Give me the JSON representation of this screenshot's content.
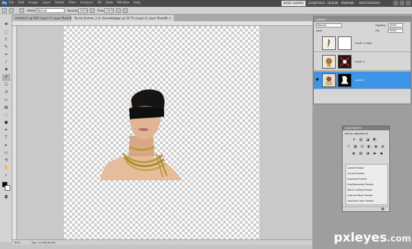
{
  "app": {
    "logo": "Ps"
  },
  "menubar": {
    "items": [
      "File",
      "Edit",
      "Image",
      "Layer",
      "Select",
      "Filter",
      "Analysis",
      "3D",
      "View",
      "Window",
      "Help"
    ],
    "workspaces": [
      "BASIC SHAPES",
      "ESSENTIALS",
      "DESIGN",
      "PAINTING",
      "PHOTOGRAPHY"
    ],
    "active_workspace": "BASIC SHAPES"
  },
  "options_bar": {
    "mode_label": "Mode:",
    "mode_value": "Normal",
    "opacity_label": "Opacity:",
    "opacity_value": "100%",
    "flow_label": "Flow:",
    "flow_value": "100%"
  },
  "tabs": [
    {
      "label": "Untitled-1 @ 50% (Layer 0, Layer Mask/8) ×",
      "active": false
    },
    {
      "label": "Tarnet_Human_1.hc (Snowtolgtga) @ 50.7% (Layer 0, Layer Mask/8) ×",
      "active": true
    }
  ],
  "statusbar": {
    "zoom": "50%",
    "doc": "Doc: 12.9M/46.9M"
  },
  "layers_panel": {
    "title": "LAYERS",
    "blend_mode": "Normal",
    "opacity_label": "Opacity:",
    "opacity_value": "100%",
    "lock_label": "Lock:",
    "fill_label": "Fill:",
    "fill_value": "100%",
    "layers": [
      {
        "name": "Layer 1 copy",
        "visible": false,
        "selected": false
      },
      {
        "name": "Layer 1",
        "visible": false,
        "selected": false
      },
      {
        "name": "Layer 0",
        "visible": true,
        "selected": true
      }
    ]
  },
  "adjustments_panel": {
    "title": "ADJUSTMENTS",
    "subtitle": "Add an adjustment",
    "presets": [
      "Levels Presets",
      "Curves Presets",
      "Exposure Presets",
      "Hue/Saturation Presets",
      "Black & White Presets",
      "Channel Mixer Presets",
      "Selective Color Presets"
    ]
  },
  "watermark": {
    "main": "pxleyes",
    "tld": ".com"
  }
}
